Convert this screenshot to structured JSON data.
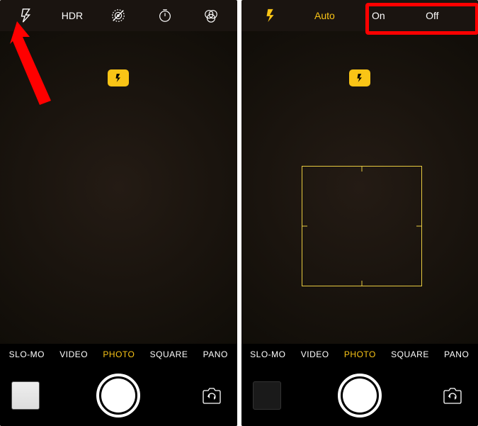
{
  "left": {
    "topbar": {
      "hdr": "HDR"
    },
    "modes": [
      "SLO-MO",
      "VIDEO",
      "PHOTO",
      "SQUARE",
      "PANO"
    ],
    "active_mode_index": 2
  },
  "right": {
    "topbar": {
      "auto": "Auto",
      "on": "On",
      "off": "Off"
    },
    "modes": [
      "SLO-MO",
      "VIDEO",
      "PHOTO",
      "SQUARE",
      "PANO"
    ],
    "active_mode_index": 2
  }
}
